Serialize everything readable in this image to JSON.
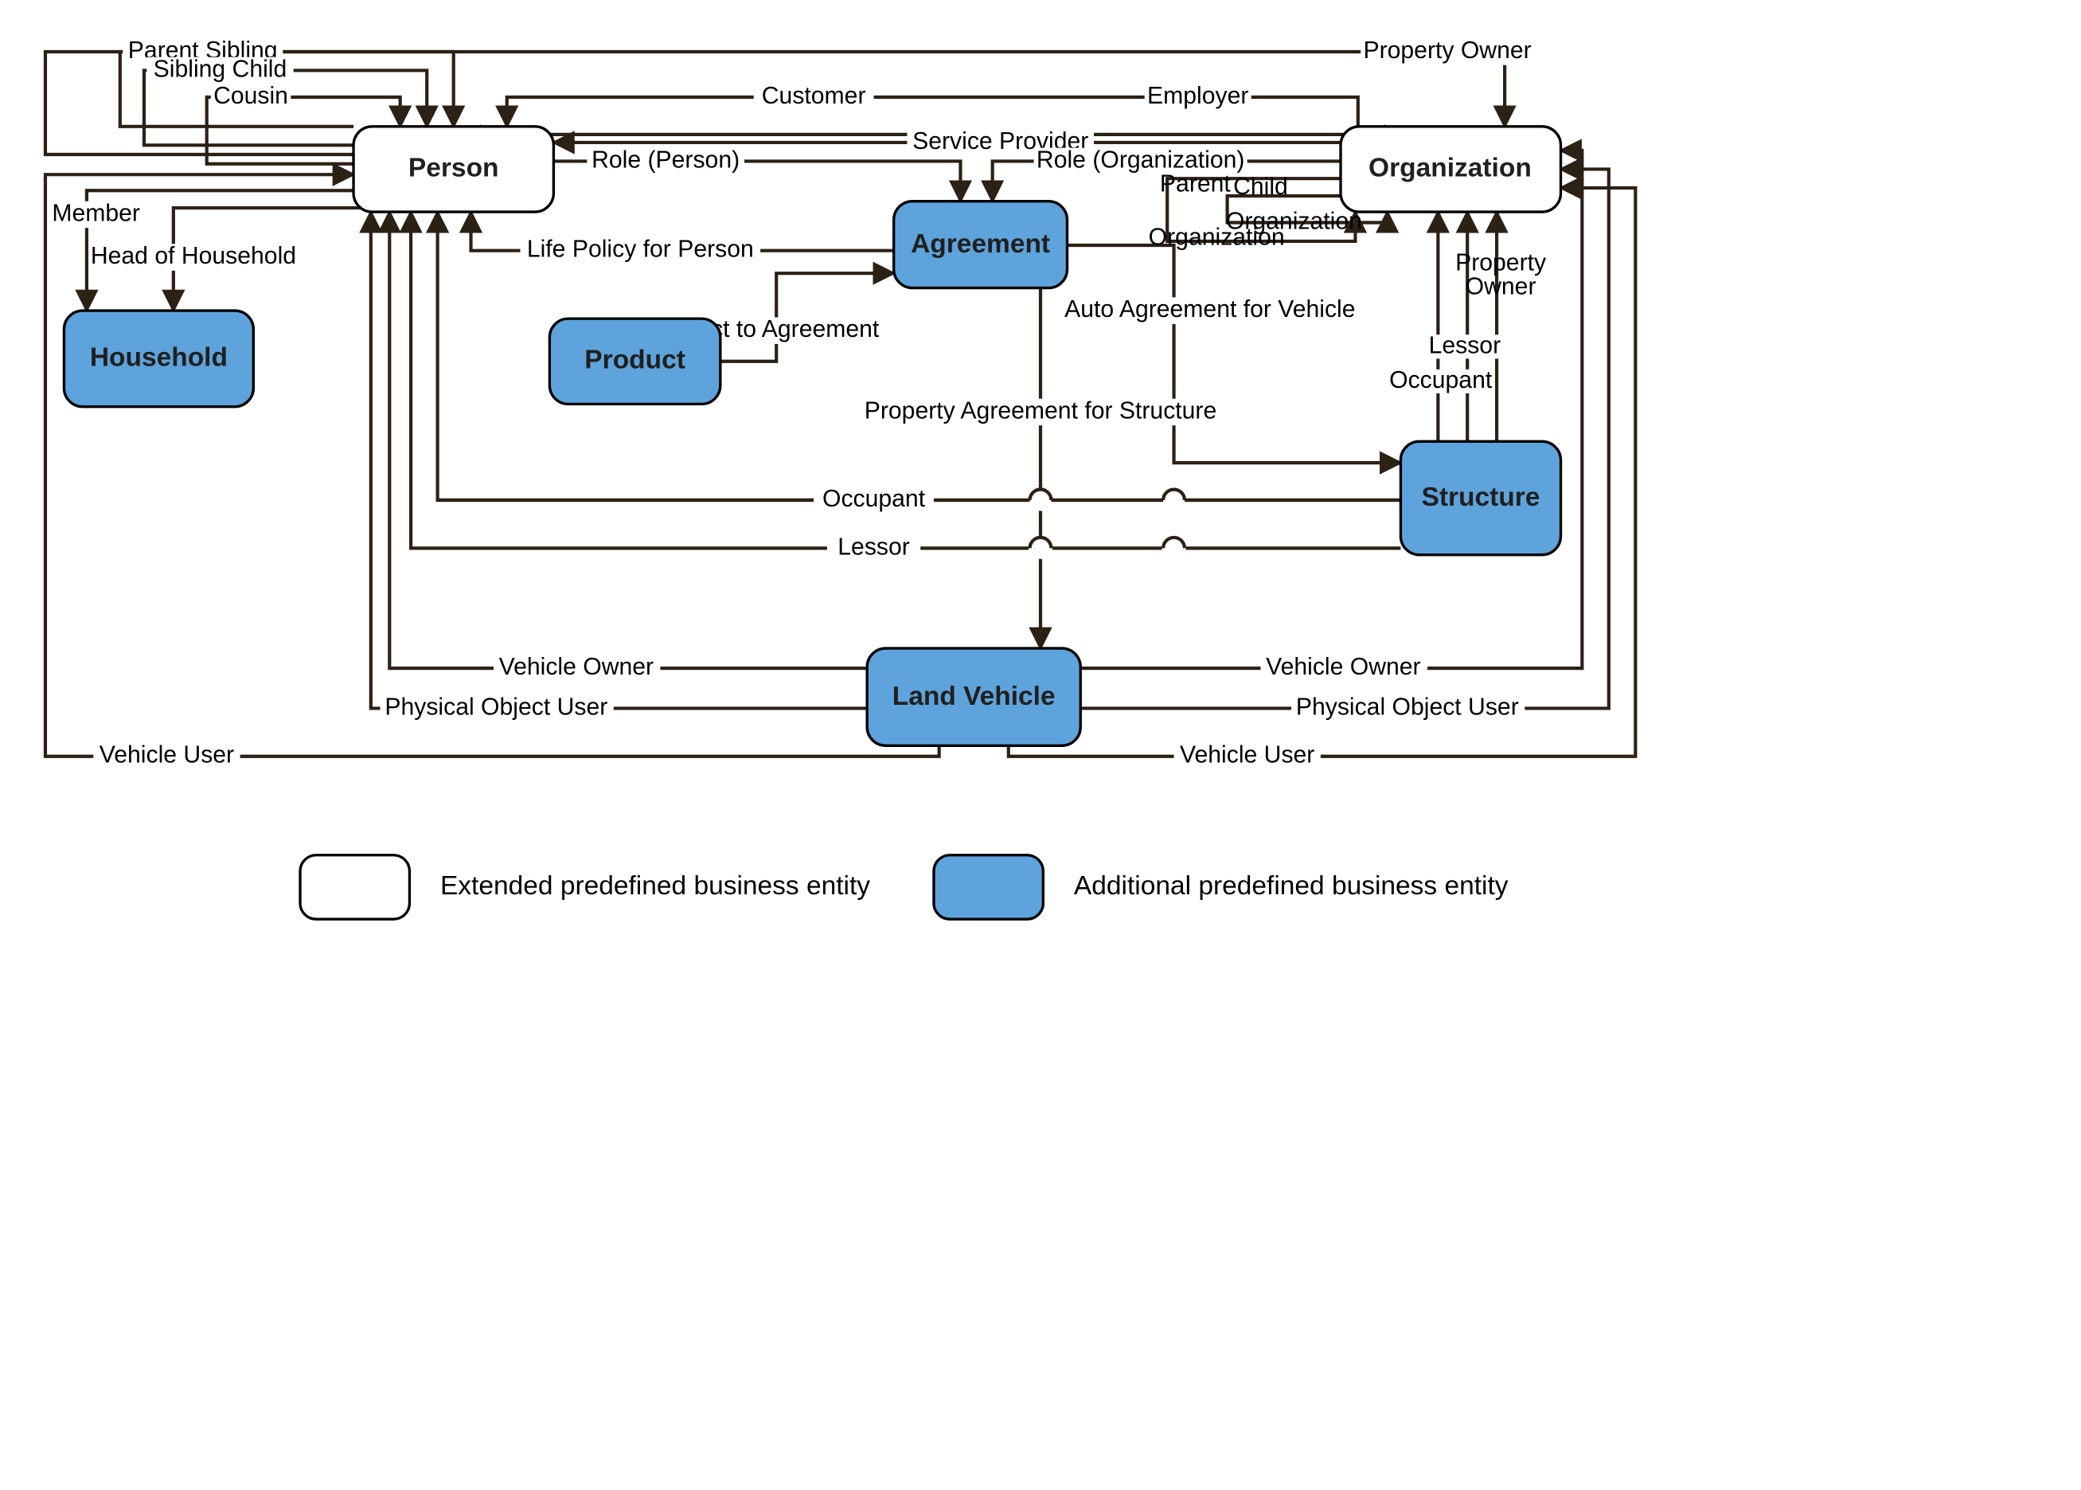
{
  "entities": {
    "person": "Person",
    "organization": "Organization",
    "household": "Household",
    "agreement": "Agreement",
    "product": "Product",
    "structure": "Structure",
    "landVehicle": "Land Vehicle"
  },
  "edges": {
    "parentSibling": "Parent Sibling",
    "siblingChild": "Sibling Child",
    "cousin": "Cousin",
    "member": "Member",
    "headOfHousehold": "Head of Household",
    "customer": "Customer",
    "employer": "Employer",
    "propertyOwnerTop": "Property Owner",
    "serviceProvider": "Service Provider",
    "rolePerson": "Role (Person)",
    "roleOrganization": "Role (Organization)",
    "parentOrganization1": "Parent",
    "parentOrganization2": "Organization",
    "childOrganization1": "Child",
    "childOrganization2": "Organization",
    "lifePolicy": "Life Policy for Person",
    "productToAgreement": "Product to Agreement",
    "autoAgreement": "Auto Agreement for Vehicle",
    "propertyAgreement": "Property Agreement for Structure",
    "occupantPerson": "Occupant",
    "lessorPerson": "Lessor",
    "occupantOrg": "Occupant",
    "lessorOrg": "Lessor",
    "propertyOwnerOrg1": "Property",
    "propertyOwnerOrg2": "Owner",
    "vehicleOwnerPerson": "Vehicle Owner",
    "physicalObjectUserPerson": "Physical Object User",
    "vehicleUserPerson": "Vehicle User",
    "vehicleOwnerOrg": "Vehicle Owner",
    "physicalObjectUserOrg": "Physical Object User",
    "vehicleUserOrg": "Vehicle User"
  },
  "legend": {
    "extended": "Extended predefined business entity",
    "additional": "Additional predefined business entity"
  }
}
